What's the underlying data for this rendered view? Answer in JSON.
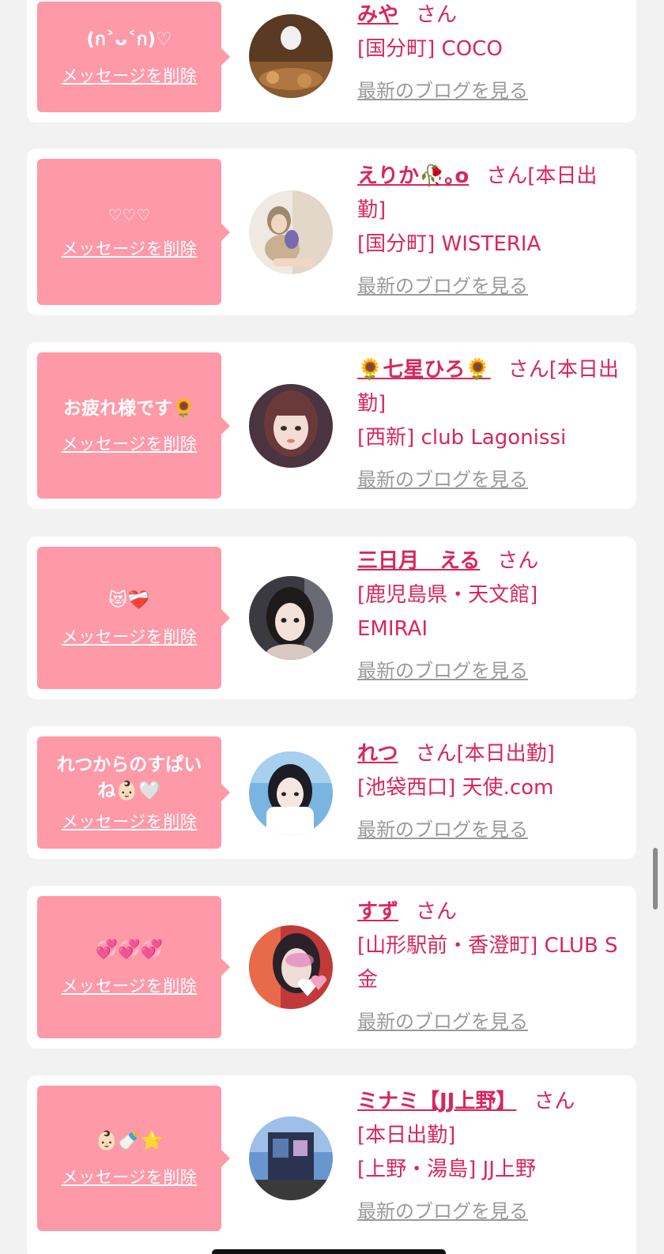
{
  "favorites": [
    {
      "message": "(ก˃ᴗ˂ก)♡",
      "delete_label": "メッセージを削除",
      "name": "みや",
      "honorific": "さん",
      "attendance": "",
      "area_shop": "[国分町] COCO",
      "blog_label": "最新のブログを見る"
    },
    {
      "message": "♡♡♡",
      "delete_label": "メッセージを削除",
      "name": "えりか🥀｡o",
      "honorific": "さん",
      "attendance": "[本日出勤]",
      "area_shop": "[国分町] WISTERIA",
      "blog_label": "最新のブログを見る"
    },
    {
      "message": "お疲れ様です🌻",
      "delete_label": "メッセージを削除",
      "name": "🌻七星ひろ🌻",
      "honorific": "さん",
      "attendance": "[本日出勤]",
      "area_shop": "[西新] club Lagonissi",
      "blog_label": "最新のブログを見る"
    },
    {
      "message": "😻❤️‍🩹",
      "delete_label": "メッセージを削除",
      "name": "三日月　える",
      "honorific": "さん",
      "attendance": "",
      "area_shop": "[鹿児島県・天文館] EMIRAI",
      "blog_label": "最新のブログを見る"
    },
    {
      "message": "れつからのすぱいね👶🏻🤍",
      "delete_label": "メッセージを削除",
      "name": "れつ",
      "honorific": "さん",
      "attendance": "[本日出勤]",
      "area_shop": "[池袋西口] 天使.com",
      "blog_label": "最新のブログを見る"
    },
    {
      "message": "💞💞💞",
      "delete_label": "メッセージを削除",
      "name": "すず",
      "honorific": "さん",
      "attendance": "",
      "area_shop": "[山形駅前・香澄町] CLUB S金",
      "blog_label": "最新のブログを見る"
    },
    {
      "message": "👶🏻🍼⭐",
      "delete_label": "メッセージを削除",
      "name": "ミナミ【JJ上野】",
      "honorific": "さん",
      "attendance": "[本日出勤]",
      "area_shop": "[上野・湯島] JJ上野",
      "blog_label": "最新のブログを見る"
    }
  ],
  "colors": {
    "page_background": "#f2f2f2",
    "card_background": "#ffffff",
    "bubble": "#fe99a8",
    "accent_pink": "#d9265c",
    "link_gray": "#9a9a9a"
  }
}
